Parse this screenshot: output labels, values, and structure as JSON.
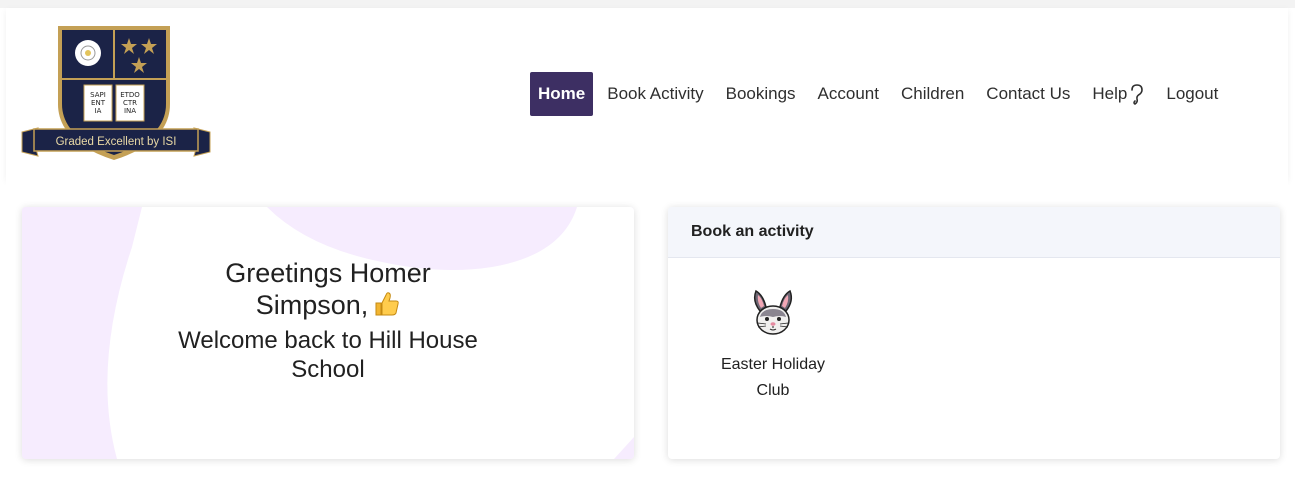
{
  "logo": {
    "ribbon_text": "Graded Excellent by ISI",
    "book_text": [
      "SAPI",
      "ENT",
      "IA",
      "ETDO",
      "CTR",
      "INA"
    ]
  },
  "nav": {
    "items": [
      {
        "label": "Home",
        "active": true
      },
      {
        "label": "Book Activity"
      },
      {
        "label": "Bookings"
      },
      {
        "label": "Account"
      },
      {
        "label": "Children"
      },
      {
        "label": "Contact Us"
      },
      {
        "label": "Help"
      },
      {
        "label": "Logout"
      }
    ],
    "active_color": "#3d2f63"
  },
  "greeting": {
    "line1": "Greetings Homer",
    "line2": "Simpson,",
    "line3": "Welcome back to Hill House",
    "line4": "School",
    "emoji_icon": "thumbs-up-icon"
  },
  "book_panel": {
    "title": "Book an activity",
    "activities": [
      {
        "label_line1": "Easter Holiday",
        "label_line2": "Club",
        "icon": "rabbit-face-icon"
      }
    ]
  },
  "colors": {
    "accent": "#3d2f63",
    "card_bg": "#f6ecfe",
    "card_blob": "#eedcfd",
    "logo_navy": "#1b2347",
    "logo_gold": "#c4a055"
  }
}
